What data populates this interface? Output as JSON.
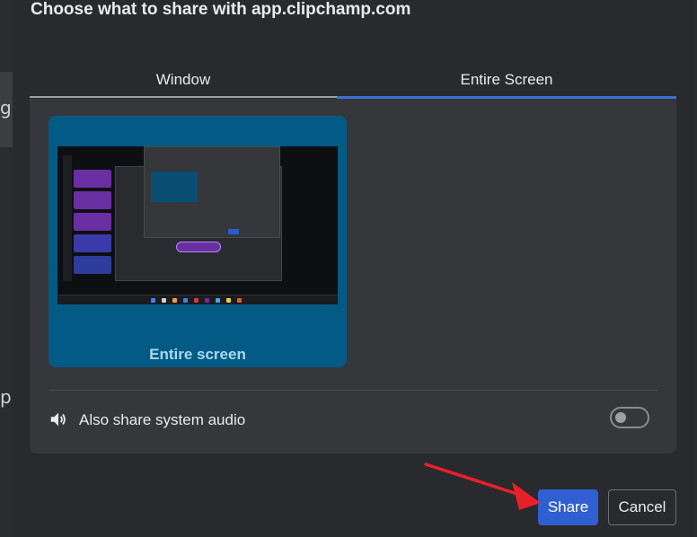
{
  "dialog": {
    "title": "Choose what to share with app.clipchamp.com"
  },
  "tabs": [
    {
      "label": "Window",
      "selected": false
    },
    {
      "label": "Entire Screen",
      "selected": true
    }
  ],
  "screens": [
    {
      "label": "Entire screen",
      "selected": true
    }
  ],
  "audio": {
    "label": "Also share system audio",
    "enabled": false,
    "icon": "speaker-icon"
  },
  "buttons": {
    "share_label": "Share",
    "cancel_label": "Cancel"
  },
  "background": {
    "letter_top": "g",
    "letter_bottom": "p"
  },
  "colors": {
    "accent": "#3d6fd9",
    "share_button": "#2f5fd1",
    "card_background": "#035a85",
    "annotation_arrow": "#e8202a"
  }
}
